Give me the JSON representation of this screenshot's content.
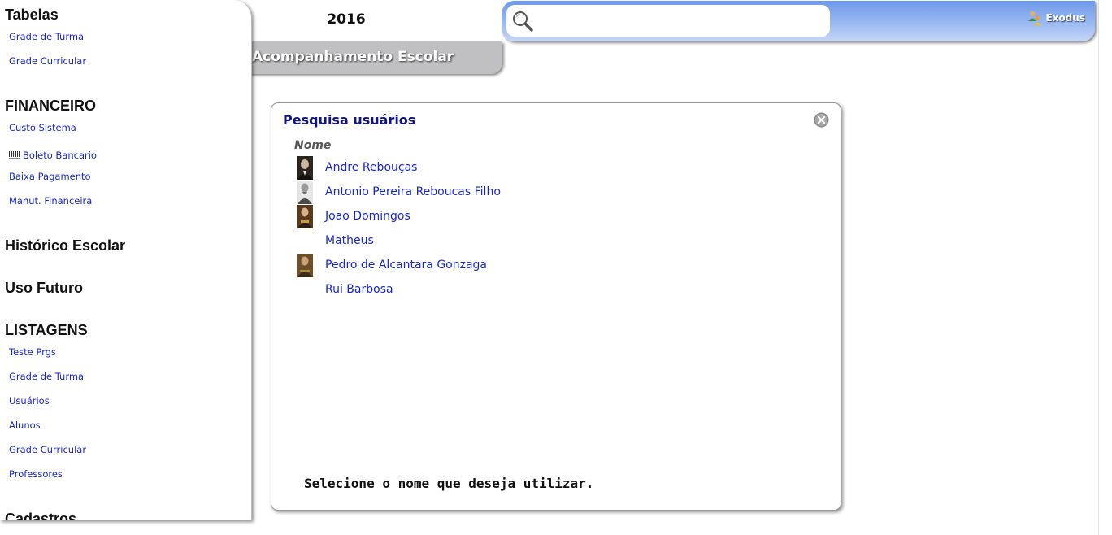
{
  "header": {
    "year": "2016",
    "title": "Acompanhamento Escolar",
    "search": {
      "placeholder": "",
      "value": ""
    },
    "user": {
      "name": "Exodus",
      "icon": "user-icon"
    }
  },
  "sidebar": {
    "sections": [
      {
        "title": "Tabelas",
        "items": [
          "Grade de Turma",
          "Grade Curricular"
        ]
      },
      {
        "title": "FINANCEIRO",
        "items": [
          "Custo Sistema",
          "Boleto Bancario",
          "Baixa Pagamento",
          "Manut. Financeira"
        ]
      },
      {
        "title": "Histórico Escolar",
        "items": []
      },
      {
        "title": "Uso Futuro",
        "items": []
      },
      {
        "title": "LISTAGENS",
        "items": [
          "Teste Prgs",
          "Grade de Turma",
          "Usuários",
          "Alunos",
          "Grade Curricular",
          "Professores"
        ]
      },
      {
        "title": "Cadastros",
        "items": []
      }
    ]
  },
  "dialog": {
    "title": "Pesquisa usuários",
    "column_header": "Nome",
    "users": [
      {
        "name": "Andre Rebouças",
        "has_photo": true
      },
      {
        "name": "Antonio Pereira Reboucas Filho",
        "has_photo": true
      },
      {
        "name": "Joao Domingos",
        "has_photo": true
      },
      {
        "name": "Matheus",
        "has_photo": false
      },
      {
        "name": "Pedro de Alcantara Gonzaga",
        "has_photo": true
      },
      {
        "name": "Rui Barbosa",
        "has_photo": false
      }
    ],
    "footer": "Selecione o nome que deseja utilizar."
  },
  "colors": {
    "link": "#1a27c9",
    "dialog_title": "#121480",
    "top_bar": "#6d98e9",
    "title_tab": "#c0c0c2"
  }
}
